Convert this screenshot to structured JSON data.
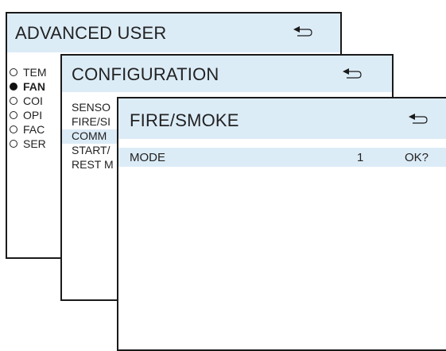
{
  "colors": {
    "header_bg": "#dcecf7",
    "border": "#1a1a1a",
    "text": "#222222"
  },
  "advanced_user": {
    "title": "ADVANCED USER",
    "back_icon": "back-arrow-icon",
    "items": [
      {
        "label": "TEM",
        "selected": false
      },
      {
        "label": "FAN",
        "selected": true
      },
      {
        "label": "COI",
        "selected": false
      },
      {
        "label": "OPI",
        "selected": false
      },
      {
        "label": "FAC",
        "selected": false
      },
      {
        "label": "SER",
        "selected": false
      }
    ]
  },
  "configuration": {
    "title": "CONFIGURATION",
    "back_icon": "back-arrow-icon",
    "items": [
      {
        "label": "SENSO"
      },
      {
        "label": "FIRE/SI"
      },
      {
        "label": "COMM"
      },
      {
        "label": "START/"
      },
      {
        "label": "REST M"
      }
    ]
  },
  "fire_smoke": {
    "title": "FIRE/SMOKE",
    "back_icon": "back-arrow-icon",
    "row": {
      "label": "MODE",
      "value": "1",
      "confirm": "OK?"
    }
  }
}
